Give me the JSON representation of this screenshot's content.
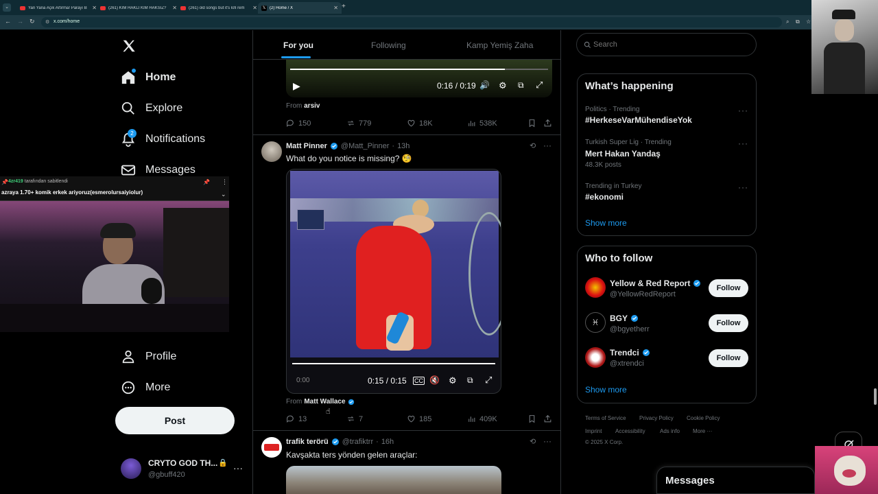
{
  "browser": {
    "tabs": [
      {
        "title": "Yan Yana Açık Artırma! Parayı B",
        "active": false
      },
      {
        "title": "(261) KİM HAKLI KİM HAKSIZ?",
        "active": false
      },
      {
        "title": "(261) old songs but it's lofi rem",
        "active": false
      },
      {
        "title": "(2) Home / X",
        "active": true
      }
    ],
    "url": "x.com/home"
  },
  "nav": {
    "items": [
      {
        "label": "Home"
      },
      {
        "label": "Explore"
      },
      {
        "label": "Notifications",
        "badge": "2"
      },
      {
        "label": "Messages"
      },
      {
        "label": "Profile"
      },
      {
        "label": "More"
      }
    ],
    "post_label": "Post",
    "account": {
      "name": "CRYTO GOD TH...",
      "handle": "@gbuff420"
    }
  },
  "stream_overlay": {
    "pinned_user": "4zr419",
    "pinned_suffix": "tarafından sabitlendi",
    "message": "azraya 1.70+ komik erkek ariyoruz(esmerolursaiyiolur)"
  },
  "feed": {
    "tabs": [
      "For you",
      "Following",
      "Kamp Yemiş Zaha"
    ],
    "top_video": {
      "time": "0:16 / 0:19",
      "from_label": "From",
      "from_name": "arsiv",
      "replies": "150",
      "reposts": "779",
      "likes": "18K",
      "views": "538K"
    },
    "post1": {
      "name": "Matt Pinner",
      "handle": "@Matt_Pinner",
      "time": "13h",
      "text": "What do you notice is missing? 🧐",
      "video_left": "0:00",
      "video_time": "0:15 / 0:15",
      "from_label": "From",
      "from_name": "Matt Wallace",
      "replies": "13",
      "reposts": "7",
      "likes": "185",
      "views": "409K"
    },
    "post2": {
      "name": "trafik terörü",
      "handle": "@trafiktrr",
      "time": "16h",
      "text": "Kavşakta ters yönden gelen araçlar:"
    }
  },
  "sidebar": {
    "search_placeholder": "Search",
    "trends_title": "What’s happening",
    "trends": [
      {
        "meta": "Politics · Trending",
        "name": "#HerkeseVarMühendiseYok",
        "posts": ""
      },
      {
        "meta": "Turkish Super Lig · Trending",
        "name": "Mert Hakan Yandaş",
        "posts": "48.3K posts"
      },
      {
        "meta": "Trending in Turkey",
        "name": "#ekonomi",
        "posts": ""
      }
    ],
    "show_more": "Show more",
    "who_title": "Who to follow",
    "who": [
      {
        "name": "Yellow & Red Report",
        "handle": "@YellowRedReport"
      },
      {
        "name": "BGY",
        "handle": "@bgyetherr"
      },
      {
        "name": "Trendci",
        "handle": "@xtrendci"
      }
    ],
    "follow_label": "Follow",
    "footer": [
      "Terms of Service",
      "Privacy Policy",
      "Cookie Policy",
      "Imprint",
      "Accessibility",
      "Ads info",
      "More ···",
      "© 2025 X Corp."
    ],
    "messages_label": "Messages"
  },
  "colors": {
    "accent": "#1d9bf0",
    "bg": "#000000",
    "border": "#2f3336",
    "muted": "#71767b"
  }
}
